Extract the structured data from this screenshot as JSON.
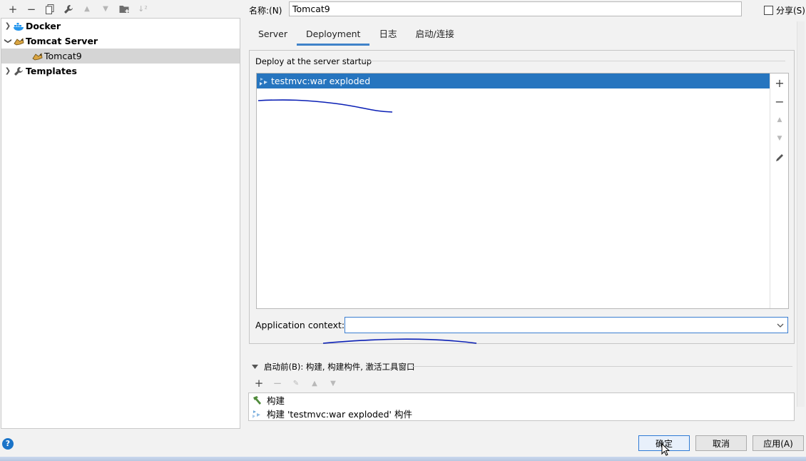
{
  "toolbar": {
    "items": [
      "add",
      "remove",
      "copy",
      "wrench",
      "move-up",
      "move-down",
      "folder-add",
      "sort"
    ],
    "glyphs": [
      "+",
      "−",
      "⧉",
      "🔧",
      "▲",
      "▼",
      "📁",
      "↓²"
    ]
  },
  "tree": {
    "items": [
      {
        "label": "Docker",
        "expanded": false
      },
      {
        "label": "Tomcat Server",
        "expanded": true
      },
      {
        "label": "Tomcat9",
        "selected": true
      },
      {
        "label": "Templates",
        "expanded": false
      }
    ]
  },
  "header": {
    "name_label": "名称:(N)",
    "name_value": "Tomcat9",
    "share_label": "分享(S)"
  },
  "tabs": [
    "Server",
    "Deployment",
    "日志",
    "启动/连接"
  ],
  "deploy": {
    "title": "Deploy at the server startup",
    "items": [
      "testmvc:war exploded"
    ],
    "context_label": "Application context:",
    "context_value": ""
  },
  "before_launch": {
    "title": "启动前(B): 构建, 构建构件, 激活工具窗口",
    "items": [
      "构建",
      "构建 'testmvc:war exploded' 构件"
    ]
  },
  "buttons": {
    "ok": "确定",
    "cancel": "取消",
    "apply": "应用(A)",
    "help": "?"
  },
  "colors": {
    "selection": "#2675bf",
    "tab_underline": "#4083c9",
    "annotation_ink": "#0a1fb5"
  }
}
